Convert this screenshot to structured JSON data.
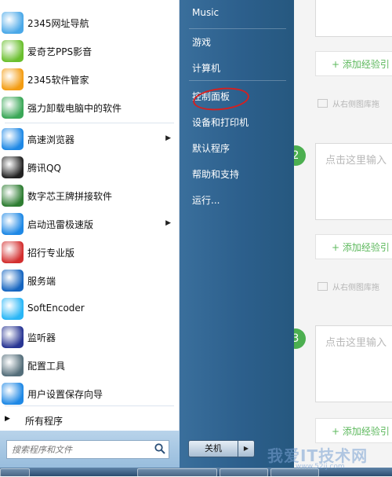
{
  "start_menu": {
    "programs": [
      {
        "label": "2345网址导航",
        "icon": "octopus-logo-icon",
        "color": "#4aa8e8",
        "has_arrow": false
      },
      {
        "label": "爱奇艺PPS影音",
        "icon": "iqiyi-tv-icon",
        "color": "#6abf2e",
        "has_arrow": false
      },
      {
        "label": "2345软件管家",
        "icon": "software-manager-icon",
        "color": "#f39c12",
        "has_arrow": false
      },
      {
        "label": "强力卸载电脑中的软件",
        "icon": "recycle-bin-icon",
        "color": "#3aa757",
        "has_arrow": false
      },
      {
        "label": "高速浏览器",
        "icon": "browser-e-icon",
        "color": "#1e88e5",
        "has_arrow": true
      },
      {
        "label": "腾讯QQ",
        "icon": "qq-penguin-icon",
        "color": "#222222",
        "has_arrow": false
      },
      {
        "label": "数字芯王牌拼接软件",
        "icon": "monitor-wall-icon",
        "color": "#2e7d32",
        "has_arrow": false
      },
      {
        "label": "启动迅雷极速版",
        "icon": "thunder-bird-icon",
        "color": "#1e88e5",
        "has_arrow": true
      },
      {
        "label": "招行专业版",
        "icon": "cmb-bank-icon",
        "color": "#d32f2f",
        "has_arrow": false
      },
      {
        "label": "服务端",
        "icon": "server-connector-icon",
        "color": "#1565c0",
        "has_arrow": false
      },
      {
        "label": "SoftEncoder",
        "icon": "globe-gear-icon",
        "color": "#29b6f6",
        "has_arrow": false
      },
      {
        "label": "监听器",
        "icon": "monitor-chart-icon",
        "color": "#283593",
        "has_arrow": false
      },
      {
        "label": "配置工具",
        "icon": "wrench-tool-icon",
        "color": "#546e7a",
        "has_arrow": false
      },
      {
        "label": "用户设置保存向导",
        "icon": "settings-gear-icon",
        "color": "#1e88e5",
        "has_arrow": false
      }
    ],
    "all_programs_label": "所有程序",
    "search_placeholder": "搜索程序和文件",
    "right_items": [
      {
        "label": "Music"
      },
      {
        "label": "游戏"
      },
      {
        "label": "计算机"
      },
      {
        "label": "控制面板"
      },
      {
        "label": "设备和打印机"
      },
      {
        "label": "默认程序"
      },
      {
        "label": "帮助和支持"
      },
      {
        "label": "运行..."
      }
    ],
    "shutdown_label": "关机"
  },
  "background_page": {
    "input_placeholder": "点击这里输入",
    "add_link": "+ 添加经验引",
    "hint": "从右侧图库拖",
    "steps": [
      "2",
      "3"
    ],
    "accent": "#4caf50"
  },
  "watermark": {
    "text": "我爱IT技术网",
    "url": "www.52ij.com"
  }
}
